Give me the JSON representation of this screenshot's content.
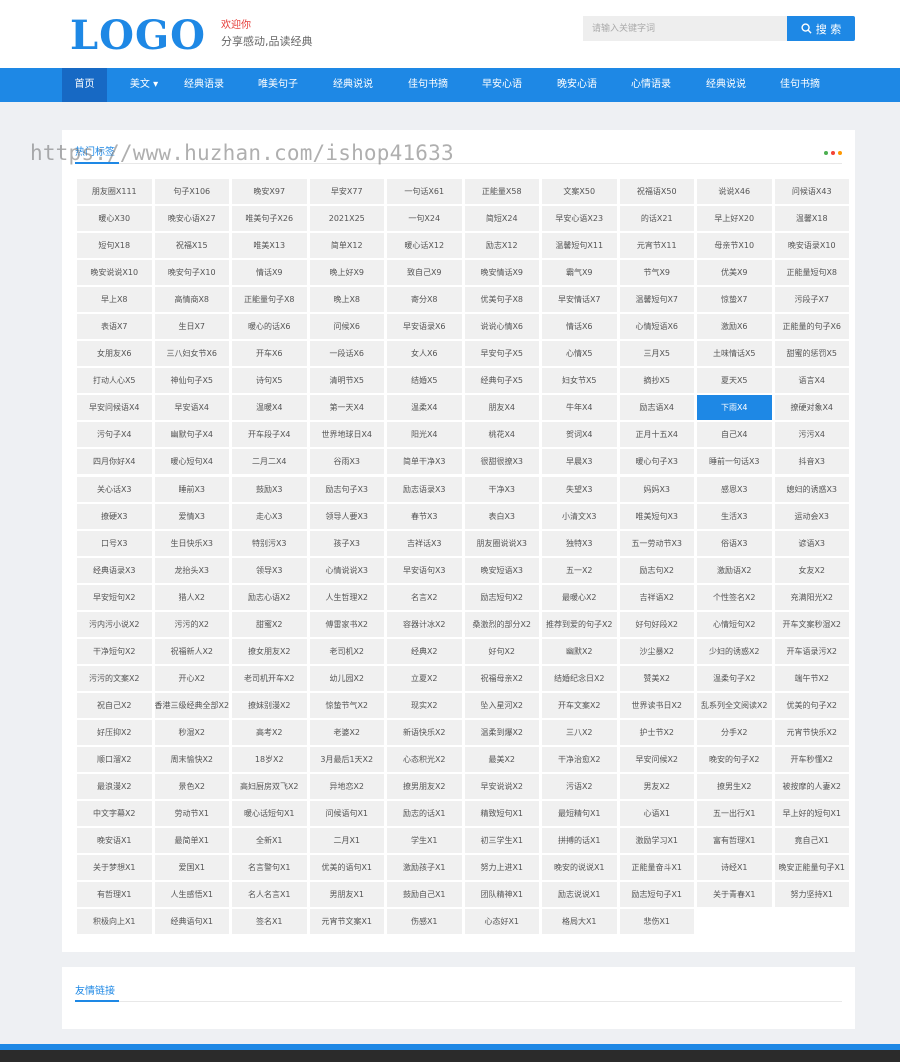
{
  "header": {
    "logo": "LOGO",
    "welcome": "欢迎你",
    "slogan": "分享感动,品读经典",
    "search_placeholder": "请输入关键字词",
    "search_label": "搜 索"
  },
  "nav": [
    "首页",
    "美文 ▾",
    "经典语录",
    "唯美句子",
    "经典说说",
    "佳句书摘",
    "早安心语",
    "晚安心语",
    "心情语录",
    "经典说说",
    "佳句书摘"
  ],
  "hot_tags": {
    "title": "热门标签",
    "watermark": "https://www.huzhan.com/ishop41633",
    "dot_colors": [
      "#4caf50",
      "#f44336",
      "#ff9800"
    ],
    "highlight_color": "#1e88e5",
    "highlighted": "下雨X4",
    "tags": [
      "朋友圈X111",
      "句子X106",
      "晚安X97",
      "早安X77",
      "一句话X61",
      "正能量X58",
      "文案X50",
      "祝福语X50",
      "说说X46",
      "问候语X43",
      "暖心X30",
      "晚安心语X27",
      "唯美句子X26",
      "2021X25",
      "一句X24",
      "简短X24",
      "早安心语X23",
      "的话X21",
      "早上好X20",
      "温馨X18",
      "短句X18",
      "祝福X15",
      "唯美X13",
      "简单X12",
      "暖心话X12",
      "励志X12",
      "温馨短句X11",
      "元宵节X11",
      "母亲节X10",
      "晚安语录X10",
      "晚安说说X10",
      "晚安句子X10",
      "情话X9",
      "晚上好X9",
      "致自己X9",
      "晚安情话X9",
      "霸气X9",
      "节气X9",
      "优美X9",
      "正能量短句X8",
      "早上X8",
      "高情商X8",
      "正能量句子X8",
      "晚上X8",
      "寄分X8",
      "优美句子X8",
      "早安情话X7",
      "温馨短句X7",
      "惊蛰X7",
      "污段子X7",
      "表语X7",
      "生日X7",
      "暖心的话X6",
      "问候X6",
      "早安语录X6",
      "说说心情X6",
      "情话X6",
      "心情短语X6",
      "激励X6",
      "正能量的句子X6",
      "女朋友X6",
      "三八妇女节X6",
      "开车X6",
      "一段话X6",
      "女人X6",
      "早安句子X5",
      "心情X5",
      "三月X5",
      "土味情话X5",
      "甜蜜的惩罚X5",
      "打动人心X5",
      "神仙句子X5",
      "诗句X5",
      "清明节X5",
      "结婚X5",
      "经典句子X5",
      "妇女节X5",
      "摘抄X5",
      "夏天X5",
      "语言X4",
      "早安问候语X4",
      "早安语X4",
      "温暖X4",
      "第一天X4",
      "温柔X4",
      "朋友X4",
      "牛年X4",
      "励志语X4",
      "下雨X4",
      "撩硬对象X4",
      "污句子X4",
      "幽默句子X4",
      "开车段子X4",
      "世界地球日X4",
      "阳光X4",
      "桃花X4",
      "贺词X4",
      "正月十五X4",
      "自己X4",
      "污污X4",
      "四月你好X4",
      "暖心短句X4",
      "二月二X4",
      "谷雨X3",
      "简单干净X3",
      "很甜很撩X3",
      "早晨X3",
      "暖心句子X3",
      "睡前一句话X3",
      "抖音X3",
      "关心话X3",
      "睡前X3",
      "鼓励X3",
      "励志句子X3",
      "励志语录X3",
      "干净X3",
      "失望X3",
      "妈妈X3",
      "感恩X3",
      "媳妇的诱惑X3",
      "撩硬X3",
      "爱情X3",
      "走心X3",
      "领导人要X3",
      "春节X3",
      "表白X3",
      "小清文X3",
      "唯美短句X3",
      "生活X3",
      "运动会X3",
      "口号X3",
      "生日快乐X3",
      "特别污X3",
      "孩子X3",
      "吉祥话X3",
      "朋友圈说说X3",
      "独特X3",
      "五一劳动节X3",
      "俗语X3",
      "谚语X3",
      "经典语录X3",
      "龙抬头X3",
      "领导X3",
      "心情说说X3",
      "早安语句X3",
      "晚安短语X3",
      "五一X2",
      "励志句X2",
      "激励语X2",
      "女友X2",
      "早安短句X2",
      "猎人X2",
      "励志心语X2",
      "人生哲理X2",
      "名言X2",
      "励志短句X2",
      "最暖心X2",
      "吉祥语X2",
      "个性签名X2",
      "充满阳光X2",
      "污内污小说X2",
      "污污的X2",
      "甜蜜X2",
      "傅雷家书X2",
      "容器计冰X2",
      "桑激烈的部分X2",
      "推荐到爱的句子X2",
      "好句好段X2",
      "心情短句X2",
      "开车文案秒湿X2",
      "干净短句X2",
      "祝福新人X2",
      "撩女朋友X2",
      "老司机X2",
      "经典X2",
      "好句X2",
      "幽默X2",
      "沙尘暴X2",
      "少妇的诱惑X2",
      "开车语录污X2",
      "污污的文案X2",
      "开心X2",
      "老司机开车X2",
      "幼儿园X2",
      "立夏X2",
      "祝福母亲X2",
      "结婚纪念日X2",
      "赞美X2",
      "温柔句子X2",
      "端午节X2",
      "祝自己X2",
      "香港三级经典全部X2",
      "撩妹别漫X2",
      "惊蛰节气X2",
      "现实X2",
      "坠入星河X2",
      "开车文案X2",
      "世界读书日X2",
      "乱系列全文阅读X2",
      "优美的句子X2",
      "好压抑X2",
      "秒湿X2",
      "高考X2",
      "老婆X2",
      "新语快乐X2",
      "温柔到爆X2",
      "三八X2",
      "护士节X2",
      "分手X2",
      "元宵节快乐X2",
      "顺口溜X2",
      "周末愉快X2",
      "18岁X2",
      "3月最后1天X2",
      "心态积光X2",
      "最美X2",
      "干净治愈X2",
      "早安问候X2",
      "晚安的句子X2",
      "开车秒懂X2",
      "最浪漫X2",
      "景色X2",
      "高妇厨房双飞X2",
      "异地恋X2",
      "撩男朋友X2",
      "早安说说X2",
      "污语X2",
      "男友X2",
      "撩男生X2",
      "被按摩的人妻X2",
      "中文字幕X2",
      "劳动节X1",
      "暖心话短句X1",
      "问候语句X1",
      "励志的话X1",
      "精致短句X1",
      "最短精句X1",
      "心语X1",
      "五一出行X1",
      "早上好的短句X1",
      "晚安语X1",
      "最简单X1",
      "全新X1",
      "二月X1",
      "学生X1",
      "初三学生X1",
      "拼搏的话X1",
      "激励学习X1",
      "富有哲理X1",
      "竟自己X1",
      "关于梦想X1",
      "爱国X1",
      "名言警句X1",
      "优美的语句X1",
      "激励孩子X1",
      "努力上进X1",
      "晚安的说说X1",
      "正能量奋斗X1",
      "诗经X1",
      "晚安正能量句子X1",
      "有哲理X1",
      "人生感悟X1",
      "名人名言X1",
      "男朋友X1",
      "鼓励自己X1",
      "团队精神X1",
      "励志说说X1",
      "励志短句子X1",
      "关于青春X1",
      "努力坚持X1",
      "积极向上X1",
      "经典语句X1",
      "签名X1",
      "元宵节文案X1",
      "伤感X1",
      "心态好X1",
      "格局大X1",
      "悲伤X1"
    ]
  },
  "links": {
    "title": "友情链接"
  }
}
